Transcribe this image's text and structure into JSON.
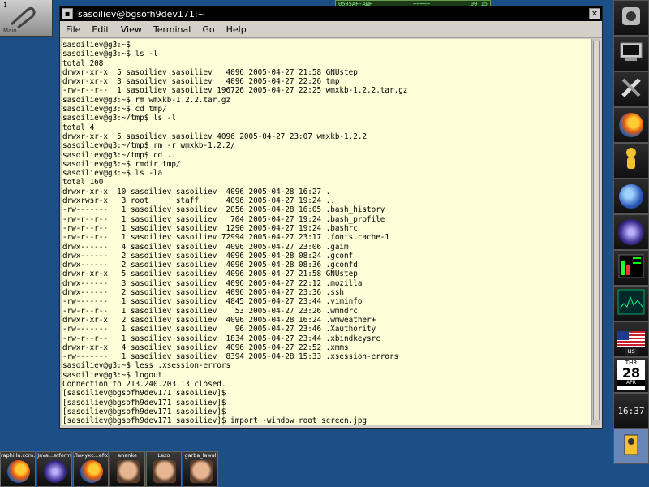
{
  "desktop": {
    "workspace_number": "1",
    "workspace_label": "Main"
  },
  "top_applet": {
    "text": "0505AF-ANP",
    "value": "00:15"
  },
  "window": {
    "title": "sasoiliev@bgsofh9dev171:~",
    "menu": [
      "File",
      "Edit",
      "View",
      "Terminal",
      "Go",
      "Help"
    ]
  },
  "terminal": {
    "lines": [
      "sasoiliev@g3:~$",
      "sasoiliev@g3:~$ ls -l",
      "total 208",
      "drwxr-xr-x  5 sasoiliev sasoiliev   4096 2005-04-27 21:58 GNUstep",
      "drwxr-xr-x  3 sasoiliev sasoiliev   4096 2005-04-27 22:26 tmp",
      "-rw-r--r--  1 sasoiliev sasoiliev 196726 2005-04-27 22:25 wmxkb-1.2.2.tar.gz",
      "sasoiliev@g3:~$ rm wmxkb-1.2.2.tar.gz",
      "sasoiliev@g3:~$ cd tmp/",
      "sasoiliev@g3:~/tmp$ ls -l",
      "total 4",
      "drwxr-xr-x  5 sasoiliev sasoiliev 4096 2005-04-27 23:07 wmxkb-1.2.2",
      "sasoiliev@g3:~/tmp$ rm -r wmxkb-1.2.2/",
      "sasoiliev@g3:~/tmp$ cd ..",
      "sasoiliev@g3:~$ rmdir tmp/",
      "sasoiliev@g3:~$ ls -la",
      "total 160",
      "drwxr-xr-x  10 sasoiliev sasoiliev  4096 2005-04-28 16:27 .",
      "drwxrwsr-x   3 root      staff      4096 2005-04-27 19:24 ..",
      "-rw-------   1 sasoiliev sasoiliev  2056 2005-04-28 16:05 .bash_history",
      "-rw-r--r--   1 sasoiliev sasoiliev   704 2005-04-27 19:24 .bash_profile",
      "-rw-r--r--   1 sasoiliev sasoiliev  1290 2005-04-27 19:24 .bashrc",
      "-rw-r--r--   1 sasoiliev sasoiliev 72994 2005-04-27 23:17 .fonts.cache-1",
      "drwx------   4 sasoiliev sasoiliev  4096 2005-04-27 23:06 .gaim",
      "drwx------   2 sasoiliev sasoiliev  4096 2005-04-28 08:24 .gconf",
      "drwx------   2 sasoiliev sasoiliev  4096 2005-04-28 08:36 .gconfd",
      "drwxr-xr-x   5 sasoiliev sasoiliev  4096 2005-04-27 21:58 GNUstep",
      "drwx------   3 sasoiliev sasoiliev  4096 2005-04-27 22:12 .mozilla",
      "drwx------   2 sasoiliev sasoiliev  4096 2005-04-27 23:36 .ssh",
      "-rw-------   1 sasoiliev sasoiliev  4845 2005-04-27 23:44 .viminfo",
      "-rw-r--r--   1 sasoiliev sasoiliev    53 2005-04-27 23:26 .wmndrc",
      "drwxr-xr-x   2 sasoiliev sasoiliev  4096 2005-04-28 16:24 .wmweather+",
      "-rw-------   1 sasoiliev sasoiliev    96 2005-04-27 23:46 .Xauthority",
      "-rw-r--r--   1 sasoiliev sasoiliev  1834 2005-04-27 23:44 .xbindkeysrc",
      "drwxr-xr-x   4 sasoiliev sasoiliev  4096 2005-04-27 22:52 .xmms",
      "-rw-------   1 sasoiliev sasoiliev  8394 2005-04-28 15:33 .xsession-errors",
      "sasoiliev@g3:~$ less .xsession-errors",
      "sasoiliev@g3:~$ logout",
      "Connection to 213.240.203.13 closed.",
      "[sasoiliev@bgsofh9dev171 sasoiliev]$",
      "[sasoiliev@bgsofh9dev171 sasoiliev]$",
      "[sasoiliev@bgsofh9dev171 sasoiliev]$",
      "[sasoiliev@bgsofh9dev171 sasoiliev]$ import -window root screen.jpg"
    ]
  },
  "dock": {
    "locale_label": "us",
    "calendar": {
      "dow": "THR",
      "day": "28",
      "month": "APR"
    },
    "clock": "16:37"
  },
  "taskbar": {
    "items": [
      {
        "label": "raphilla.com...",
        "icon": "firefox-icon"
      },
      {
        "label": "Java...atform",
        "icon": "java-icon"
      },
      {
        "label": "Линукс...efox",
        "icon": "firefox-icon"
      },
      {
        "label": "ananke",
        "icon": "avatar-icon"
      },
      {
        "label": "Lazo",
        "icon": "avatar-icon"
      },
      {
        "label": "garba_lawal",
        "icon": "avatar-icon"
      }
    ]
  }
}
